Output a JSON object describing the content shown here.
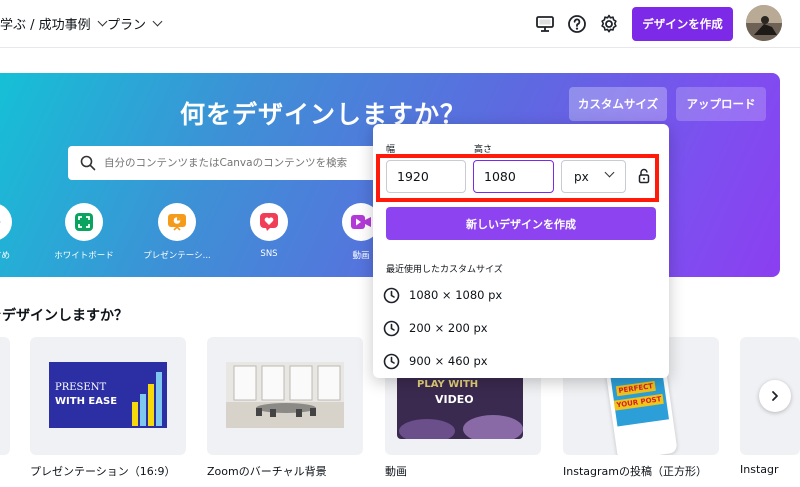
{
  "topbar": {
    "learn_label": "学ぶ / 成功事例",
    "plan_label": "プラン",
    "create_label": "デザインを作成",
    "icons": [
      "monitor-icon",
      "help-icon",
      "gear-icon"
    ]
  },
  "hero": {
    "title": "何をデザインしますか？",
    "custom_size_label": "カスタムサイズ",
    "upload_label": "アップロード",
    "search_placeholder": "自分のコンテンツまたはCanvaのコンテンツを検索",
    "categories": [
      {
        "label": "おすすめ",
        "icon": "sparkle-icon",
        "color": "#6b5bd6"
      },
      {
        "label": "ホワイトボード",
        "icon": "whiteboard-icon",
        "color": "#0ba360"
      },
      {
        "label": "プレゼンテーシ...",
        "icon": "presentation-icon",
        "color": "#f49b1b"
      },
      {
        "label": "SNS",
        "icon": "heart-icon",
        "color": "#ef3e55"
      },
      {
        "label": "動画",
        "icon": "video-icon",
        "color": "#b33ad8"
      }
    ]
  },
  "section": {
    "title": "何をデザインしますか？",
    "cards": [
      {
        "label": "プレゼンテーション（16:9）",
        "thumb_line1": "PRESENT",
        "thumb_line2": "WITH EASE"
      },
      {
        "label": "Zoomのバーチャル背景"
      },
      {
        "label": "動画",
        "thumb_line1": "PLAY WITH",
        "thumb_line2": "VIDEO"
      },
      {
        "label": "Instagramの投稿（正方形）",
        "thumb_line1": "PERFECT",
        "thumb_line2": "YOUR POST"
      },
      {
        "label": "Instagr"
      }
    ]
  },
  "custom_panel": {
    "width_label": "幅",
    "height_label": "高さ",
    "width_value": "1920",
    "height_value": "1080",
    "unit_value": "px",
    "new_design_label": "新しいデザインを作成",
    "recent_title": "最近使用したカスタムサイズ",
    "recent_sizes": [
      "1080 × 1080 px",
      "200 × 200 px",
      "900 × 460 px"
    ]
  },
  "colors": {
    "brand_purple": "#7d2ae8",
    "highlight_red": "#ff1a0a"
  }
}
